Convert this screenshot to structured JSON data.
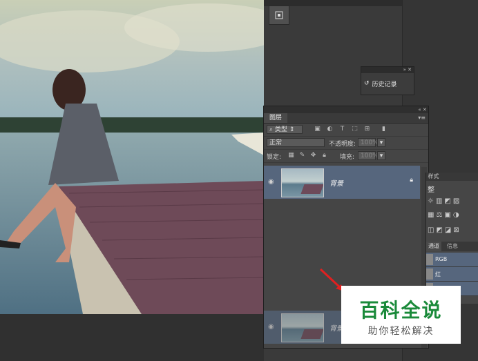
{
  "history": {
    "label": "历史记录"
  },
  "layers": {
    "tab_label": "图层",
    "filter": {
      "value": "类型"
    },
    "blend_mode": {
      "value": "正常"
    },
    "opacity": {
      "label": "不透明度:",
      "value": "100%"
    },
    "lock_label": "锁定:",
    "fill": {
      "label": "填充:",
      "value": "100%"
    },
    "items": [
      {
        "name": "背景"
      },
      {
        "name": "背景"
      }
    ]
  },
  "adjustments": {
    "header": "整"
  },
  "channels": {
    "tabs": [
      "通道",
      "信息"
    ],
    "items": [
      {
        "name": "RGB"
      },
      {
        "name": "红"
      },
      {
        "name": "绿"
      }
    ]
  },
  "watermark": {
    "title": "百科全说",
    "subtitle": "助你轻松解决"
  },
  "colors": {
    "selected_layer": "#56667d",
    "watermark_green": "#1a8a3a",
    "arrow": "#e02020"
  }
}
